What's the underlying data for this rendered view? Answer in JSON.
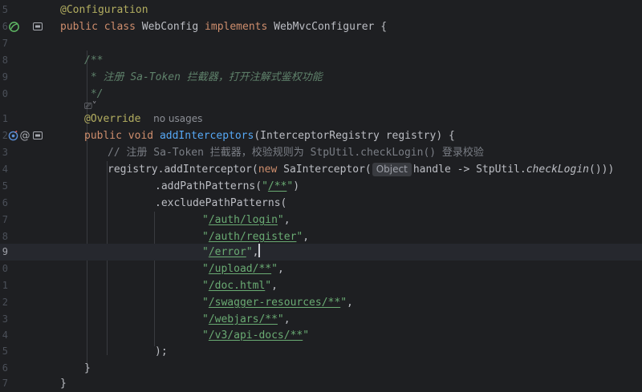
{
  "lines": {
    "l1": {
      "num": "5",
      "ann": "@Configuration"
    },
    "l2": {
      "num": "6",
      "kw1": "public",
      "kw2": "class",
      "cls": "WebConfig",
      "kw3": "implements",
      "iface": "WebMvcConfigurer",
      "brace": "{"
    },
    "l3": {
      "num": "7"
    },
    "l4": {
      "num": "8",
      "text": "/**"
    },
    "l5": {
      "num": "9",
      "text": " * 注册 ",
      "it": "Sa-Token",
      "rest": " 拦截器，打开注解式鉴权功能"
    },
    "l6": {
      "num": "0",
      "text": " */"
    },
    "l7": {
      "num": "",
      "hint_icon": "⎚˅"
    },
    "l8": {
      "num": "1",
      "ann": "@Override",
      "hint": "no usages"
    },
    "l9": {
      "num": "2",
      "kw1": "public",
      "kw2": "void",
      "fn": "addInterceptors",
      "sig": "(InterceptorRegistry registry) {"
    },
    "l10": {
      "num": "3",
      "text": "// 注册 Sa-Token 拦截器，校验规则为 StpUtil.checkLogin() 登录校验"
    },
    "l11": {
      "num": "4",
      "pre": "registry.addInterceptor(",
      "kw": "new",
      "mid": " SaInterceptor(",
      "param_hint": "Object",
      "post1": "handle -> StpUtil.",
      "it": "checkLogin",
      "post2": "()))"
    },
    "l12": {
      "num": "5",
      "pre": ".addPathPatterns(",
      "q1": "\"",
      "s": "/**",
      "q2": "\"",
      "post": ")"
    },
    "l13": {
      "num": "6",
      "text": ".excludePathPatterns("
    },
    "l14": {
      "num": "7",
      "q1": "\"",
      "s": "/auth/login",
      "q2": "\"",
      "post": ","
    },
    "l15": {
      "num": "8",
      "q1": "\"",
      "s": "/auth/register",
      "q2": "\"",
      "post": ","
    },
    "l16": {
      "num": "9",
      "q1": "\"",
      "s": "/error",
      "q2": "\"",
      "post": ","
    },
    "l17": {
      "num": "0",
      "q1": "\"",
      "s": "/upload/**",
      "q2": "\"",
      "post": ","
    },
    "l18": {
      "num": "1",
      "q1": "\"",
      "s": "/doc.html",
      "q2": "\"",
      "post": ","
    },
    "l19": {
      "num": "2",
      "q1": "\"",
      "s": "/swagger-resources/**",
      "q2": "\"",
      "post": ","
    },
    "l20": {
      "num": "3",
      "q1": "\"",
      "s": "/webjars/**",
      "q2": "\"",
      "post": ","
    },
    "l21": {
      "num": "4",
      "q1": "\"",
      "s": "/v3/api-docs/**",
      "q2": "\"",
      "post": ""
    },
    "l22": {
      "num": "5",
      "text": ");"
    },
    "l23": {
      "num": "6",
      "text": "}"
    },
    "l24": {
      "num": "7",
      "text": "}"
    }
  },
  "gutter_icons": {
    "bean": "spring-bean-icon",
    "impl": "implements-icon",
    "override": "override-icon",
    "at": "annotation-icon"
  },
  "colors": {
    "background": "#1e1f22",
    "keyword": "#cf8e6d",
    "annotation": "#b3ae60",
    "function": "#56a8f5",
    "string": "#6aab73",
    "comment": "#7a7e85",
    "doc_comment": "#5f826b"
  }
}
